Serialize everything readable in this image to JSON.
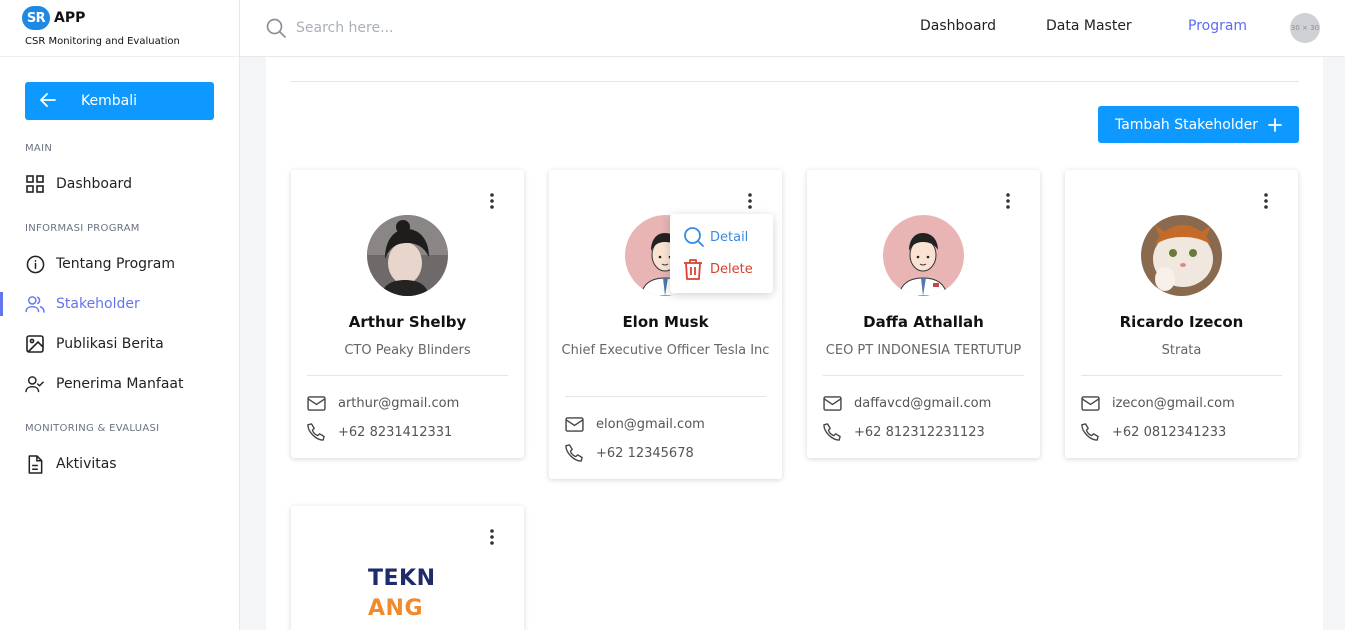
{
  "brand": {
    "logo_text": "SR",
    "name": "APP",
    "subtitle": "CSR Monitoring and Evaluation"
  },
  "sidebar": {
    "back_label": "Kembali",
    "sections": {
      "main": "MAIN",
      "program": "INFORMASI PROGRAM",
      "monitoring": "MONITORING & EVALUASI"
    },
    "items": [
      {
        "label": "Dashboard",
        "icon": "grid-icon"
      },
      {
        "label": "Tentang Program",
        "icon": "info-icon"
      },
      {
        "label": "Stakeholder",
        "icon": "users-icon",
        "active": true
      },
      {
        "label": "Publikasi Berita",
        "icon": "image-icon"
      },
      {
        "label": "Penerima Manfaat",
        "icon": "user-check-icon"
      },
      {
        "label": "Aktivitas",
        "icon": "document-icon"
      }
    ]
  },
  "topbar": {
    "search_placeholder": "Search here...",
    "links": [
      "Dashboard",
      "Data Master",
      "Program"
    ],
    "active_link": "Program",
    "avatar_text": "30 × 30"
  },
  "main": {
    "add_button_label": "Tambah Stakeholder"
  },
  "cards": [
    {
      "name": "Arthur Shelby",
      "role": "CTO Peaky Blinders",
      "email": "arthur@gmail.com",
      "phone": "+62 8231412331"
    },
    {
      "name": "Elon Musk",
      "role": "Chief Executive Officer Tesla Inc",
      "email": "elon@gmail.com",
      "phone": "+62 12345678"
    },
    {
      "name": "Daffa Athallah",
      "role": "CEO PT INDONESIA TERTUTUP",
      "email": "daffavcd@gmail.com",
      "phone": "+62 812312231123"
    },
    {
      "name": "Ricardo Izecon",
      "role": "Strata",
      "email": "izecon@gmail.com",
      "phone": "+62 0812341233"
    }
  ],
  "partial_card": {
    "logo_line1": "TEKN",
    "logo_line2": "ANG"
  },
  "popup_menu": {
    "detail": "Detail",
    "delete": "Delete"
  },
  "colors": {
    "accent": "#0d99ff",
    "active_nav": "#6474f0",
    "detail": "#3a8be0",
    "delete": "#d8412f"
  }
}
